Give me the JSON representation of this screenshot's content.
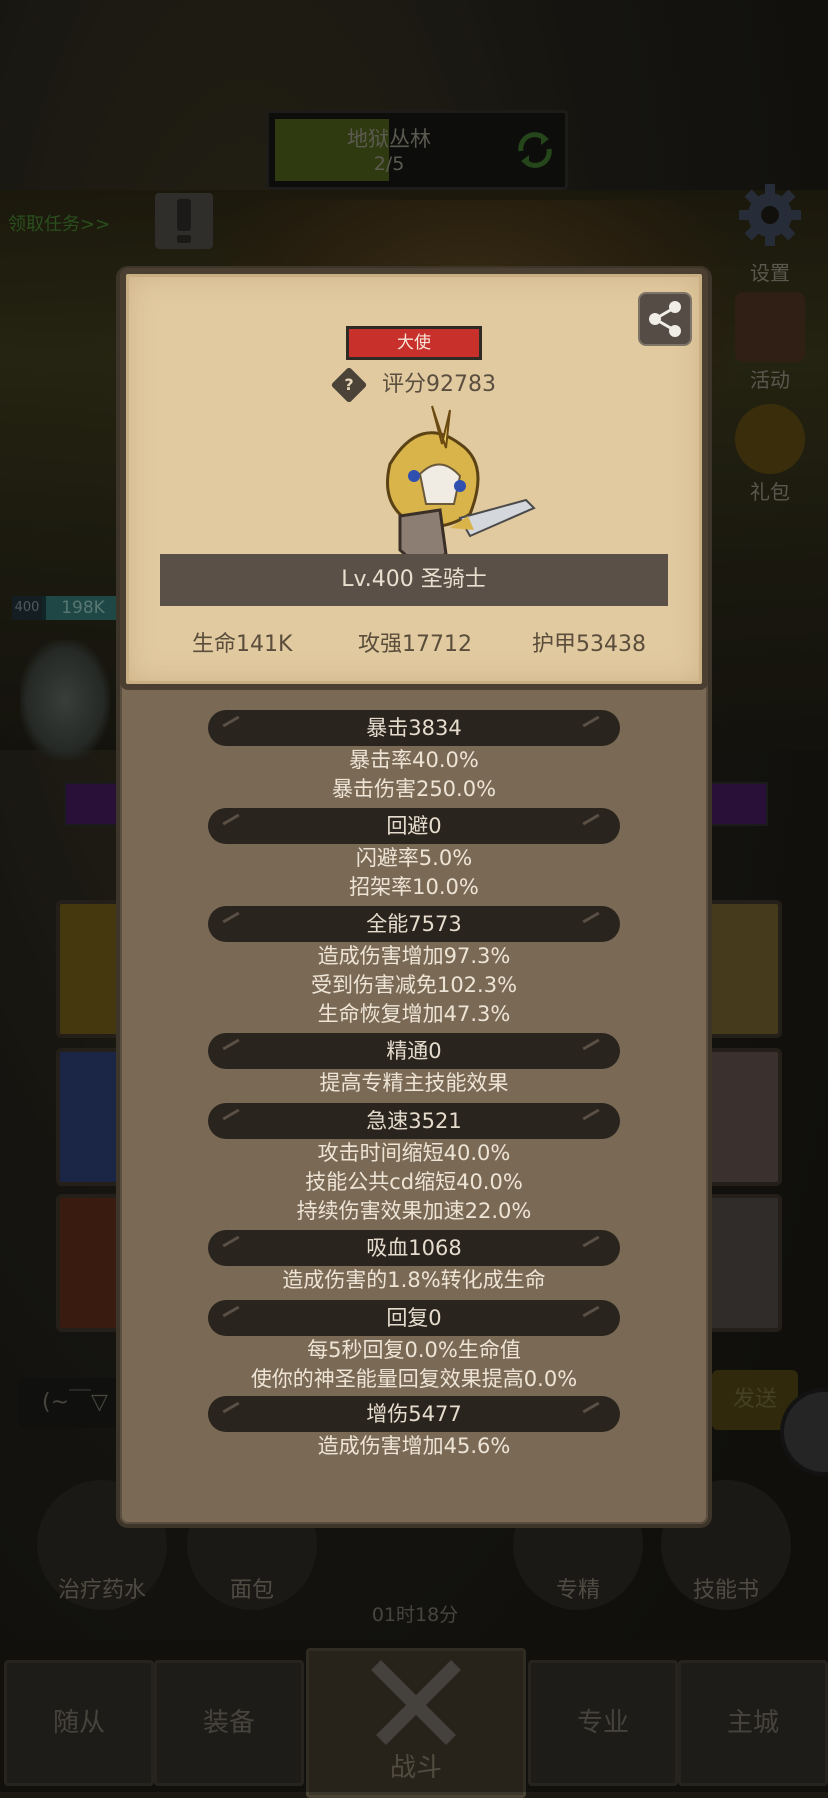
{
  "level": {
    "name": "地狱丛林",
    "progress": "2/5"
  },
  "task_link": "领取任务>>",
  "side_buttons": {
    "settings": "设置",
    "activity": "活动",
    "gift": "礼包"
  },
  "hero": {
    "level": "400",
    "hp": "198K"
  },
  "chat": {
    "placeholder": "(~￣▽",
    "send": "发送"
  },
  "items": {
    "potion": "治疗药水",
    "bread": "面包",
    "mastery": "专精",
    "skill_book": "技能书",
    "timer": "01时18分"
  },
  "nav": {
    "followers": "随从",
    "equipment": "装备",
    "battle": "战斗",
    "profession": "专业",
    "main_city": "主城"
  },
  "panel": {
    "rank": "大使",
    "score": "评分92783",
    "level_class": "Lv.400 圣骑士",
    "main_stats": {
      "hp": "生命141K",
      "attack": "攻强17712",
      "armor": "护甲53438"
    },
    "sections": [
      {
        "title": "暴击3834",
        "lines": [
          "暴击率40.0%",
          "暴击伤害250.0%"
        ]
      },
      {
        "title": "回避0",
        "lines": [
          "闪避率5.0%",
          "招架率10.0%"
        ]
      },
      {
        "title": "全能7573",
        "lines": [
          "造成伤害增加97.3%",
          "受到伤害减免102.3%",
          "生命恢复增加47.3%"
        ]
      },
      {
        "title": "精通0",
        "lines": [
          "提高专精主技能效果"
        ]
      },
      {
        "title": "急速3521",
        "lines": [
          "攻击时间缩短40.0%",
          "技能公共cd缩短40.0%",
          "持续伤害效果加速22.0%"
        ]
      },
      {
        "title": "吸血1068",
        "lines": [
          "造成伤害的1.8%转化成生命"
        ]
      },
      {
        "title": "回复0",
        "lines": [
          "每5秒回复0.0%生命值",
          "使你的神圣能量回复效果提高0.0%"
        ]
      },
      {
        "title": "增伤5477",
        "lines": [
          "造成伤害增加45.6%"
        ]
      }
    ]
  },
  "colors": {
    "rank_badge": "#c8302c",
    "panel_paper": "#e2caa0",
    "panel_body": "#7a6a55",
    "stat_header": "#2a241e"
  }
}
